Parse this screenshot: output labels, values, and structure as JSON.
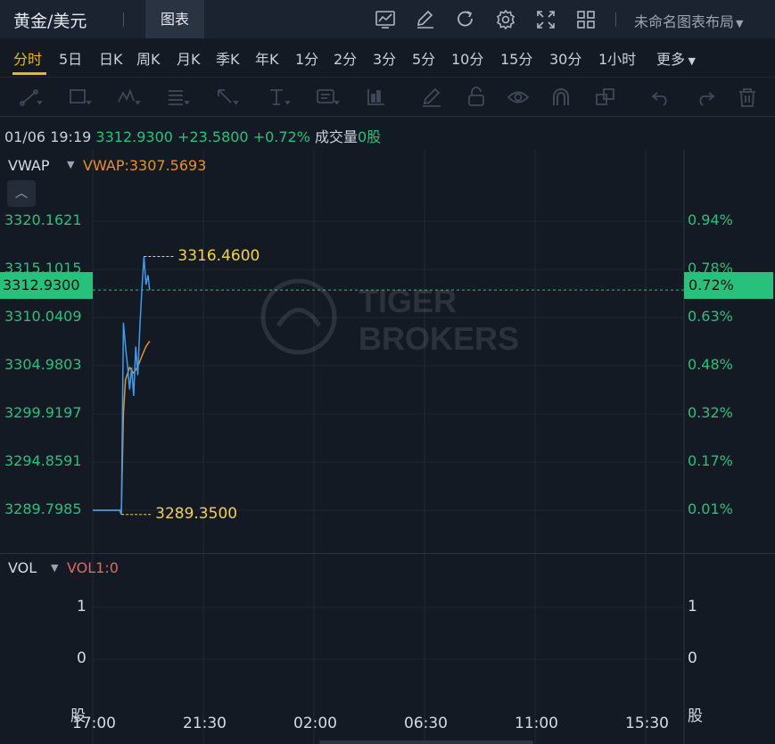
{
  "header": {
    "symbol": "黄金/美元",
    "chart_tab": "图表",
    "layout_name": "未命名图表布局",
    "tool_icons": [
      "line-chart-icon",
      "draw-pencil-icon",
      "refresh-icon",
      "settings-gear-icon",
      "fullscreen-icon",
      "grid-layout-icon"
    ]
  },
  "periods": [
    {
      "label": "分时",
      "active": true
    },
    {
      "label": "5日"
    },
    {
      "label": "日K"
    },
    {
      "label": "周K"
    },
    {
      "label": "月K"
    },
    {
      "label": "季K"
    },
    {
      "label": "年K"
    },
    {
      "label": "1分"
    },
    {
      "label": "2分"
    },
    {
      "label": "3分"
    },
    {
      "label": "5分"
    },
    {
      "label": "10分"
    },
    {
      "label": "15分"
    },
    {
      "label": "30分"
    },
    {
      "label": "1小时"
    },
    {
      "label": "更多"
    }
  ],
  "draw_tools": [
    "trend-line-icon",
    "rectangle-icon",
    "pattern-icon",
    "fib-icon",
    "arrow-icon",
    "text-icon",
    "note-icon",
    "measure-icon",
    "brush-icon",
    "lock-icon",
    "eye-icon",
    "magnet-icon",
    "clone-icon",
    "undo-icon",
    "redo-icon",
    "trash-icon"
  ],
  "quote": {
    "datetime": "01/06 19:19",
    "price": "3312.9300",
    "change": "+23.5800",
    "change_pct": "+0.72%",
    "volume_label": "成交量",
    "volume_value": "0股"
  },
  "indicator": {
    "name": "VWAP",
    "value": "VWAP:3307.5693"
  },
  "price_axis": {
    "left_labels": [
      "3320.1621",
      "3315.1015",
      "3310.0409",
      "3304.9803",
      "3299.9197",
      "3294.8591",
      "3289.7985"
    ],
    "right_labels": [
      "0.94%",
      "0.78%",
      "0.63%",
      "0.48%",
      "0.32%",
      "0.17%",
      "0.01%"
    ],
    "current_price": "3312.9300",
    "current_pct": "0.72%"
  },
  "markers": {
    "high": "3316.4600",
    "low": "3289.3500"
  },
  "volume": {
    "name": "VOL",
    "value": "VOL1:0",
    "y_labels": [
      "1",
      "0"
    ],
    "unit": "股"
  },
  "time_axis": [
    "17:00",
    "21:30",
    "02:00",
    "06:30",
    "11:00",
    "15:30"
  ],
  "watermark": {
    "line1": "TIGER",
    "line2": "BROKERS"
  },
  "colors": {
    "up": "#27c17c",
    "vwap": "#e6912a",
    "price_line": "#3d9cf0",
    "marker": "#f0d34a",
    "vol_value": "#e2685f"
  },
  "chart_data": [
    {
      "type": "line",
      "title": "",
      "xlabel": "",
      "ylabel": "",
      "x_ticks": [
        "17:00",
        "21:30",
        "02:00",
        "06:30",
        "11:00",
        "15:30"
      ],
      "ylim": [
        3286.0,
        3322.0
      ],
      "y_ticks": [
        3320.1621,
        3315.1015,
        3310.0409,
        3304.9803,
        3299.9197,
        3294.8591,
        3289.7985
      ],
      "series": [
        {
          "name": "",
          "x": [
            "17:00",
            "17:10",
            "17:15",
            "17:20",
            "17:25",
            "17:30",
            "17:35",
            "17:40",
            "17:45",
            "17:50",
            "17:55",
            "18:00",
            "18:05",
            "18:10",
            "18:15",
            "18:20",
            "18:25",
            "18:30",
            "18:35",
            "18:40",
            "18:45",
            "18:50",
            "18:55",
            "19:00",
            "19:05",
            "19:10",
            "19:15",
            "19:19"
          ],
          "values": [
            3289.8,
            3289.8,
            3289.8,
            3289.8,
            3289.8,
            3289.8,
            3289.8,
            3289.8,
            3289.8,
            3289.8,
            3289.8,
            3289.8,
            3289.8,
            3289.35,
            3309.5,
            3307.0,
            3305.0,
            3302.5,
            3304.8,
            3301.8,
            3307.0,
            3304.0,
            3309.0,
            3313.0,
            3316.46,
            3313.5,
            3314.5,
            3312.93
          ]
        },
        {
          "name": "VWAP",
          "x": [
            "17:00",
            "18:10",
            "18:15",
            "18:20",
            "18:30",
            "18:40",
            "18:50",
            "19:00",
            "19:10",
            "19:19"
          ],
          "values": [
            3289.8,
            3289.8,
            3300.0,
            3303.5,
            3304.8,
            3304.2,
            3304.9,
            3306.0,
            3307.0,
            3307.57
          ]
        }
      ],
      "grid": true
    },
    {
      "type": "bar",
      "title": "",
      "x_ticks": [
        "17:00",
        "21:30",
        "02:00",
        "06:30",
        "11:00",
        "15:30"
      ],
      "ylim": [
        0,
        1
      ],
      "series": [
        {
          "name": "VOL1",
          "values": [
            0
          ]
        }
      ]
    }
  ]
}
